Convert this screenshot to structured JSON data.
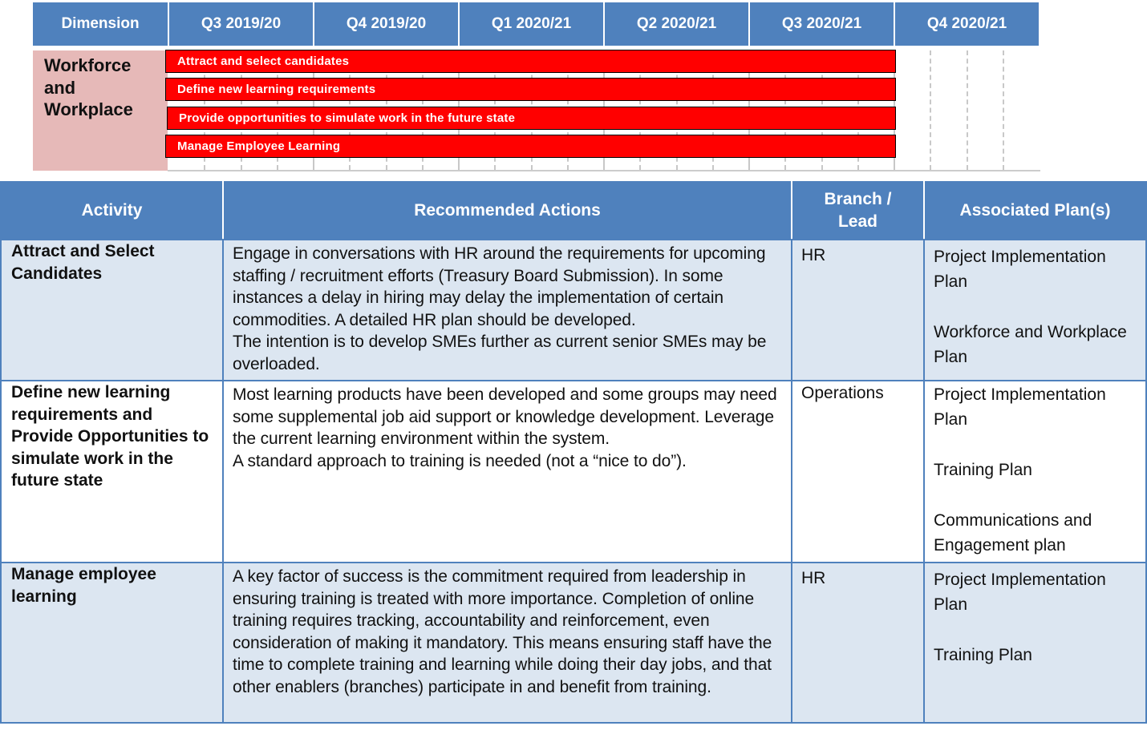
{
  "gantt": {
    "header": {
      "dimension_label": "Dimension",
      "quarters": [
        "Q3 2019/20",
        "Q4 2019/20",
        "Q1 2020/21",
        "Q2 2020/21",
        "Q3 2020/21",
        "Q4 2020/21"
      ]
    },
    "dimension": "Workforce and Workplace",
    "dimension_lines": [
      "Workforce",
      "and",
      "Workplace"
    ],
    "bars": [
      {
        "label": "Attract and select candidates",
        "start": "Q3 2019/20",
        "end": "Q3 2020/21"
      },
      {
        "label": "Define new learning requirements",
        "start": "Q3 2019/20",
        "end": "Q3 2020/21"
      },
      {
        "label": "Provide opportunities to simulate work in the future state",
        "start": "Q3 2019/20",
        "end": "Q3 2020/21"
      },
      {
        "label": "Manage Employee Learning",
        "start": "Q3 2019/20",
        "end": "Q3 2020/21"
      }
    ],
    "bar_color": "#ff0000"
  },
  "table": {
    "headers": {
      "activity": "Activity",
      "actions": "Recommended Actions",
      "lead_line1": "Branch /",
      "lead_line2": "Lead",
      "plans": "Associated Plan(s)"
    },
    "rows": [
      {
        "activity": "Attract and Select Candidates",
        "actions": [
          "Engage in conversations with HR around the requirements for upcoming staffing / recruitment efforts (Treasury Board Submission). In some instances a delay in hiring may delay the implementation of certain commodities. A detailed HR plan should be developed.",
          "The intention is to develop SMEs further as current senior SMEs may be overloaded."
        ],
        "lead": "HR",
        "plans": [
          "Project Implementation Plan",
          "Workforce and Workplace Plan"
        ]
      },
      {
        "activity": "Define new learning requirements and Provide Opportunities to simulate work in the future state",
        "actions": [
          "Most learning products have been developed and some groups may need some supplemental job aid support or knowledge development.  Leverage the current learning environment within the system.",
          "A standard approach to training is needed (not a “nice to do”)."
        ],
        "lead": "Operations",
        "plans": [
          "Project Implementation Plan",
          "Training Plan",
          "Communications and Engagement plan"
        ]
      },
      {
        "activity": "Manage employee learning",
        "actions": [
          "A key factor of success is the commitment required from leadership in ensuring training is treated with more importance.  Completion of online training requires tracking, accountability and reinforcement, even consideration of making it mandatory. This means ensuring staff have the time to complete training and learning while doing their day jobs, and that other enablers (branches) participate in and benefit from training."
        ],
        "lead": "HR",
        "plans": [
          "Project Implementation Plan",
          "Training Plan"
        ]
      }
    ],
    "colors": {
      "header": "#4f81bd",
      "band": "#dce6f1"
    }
  }
}
